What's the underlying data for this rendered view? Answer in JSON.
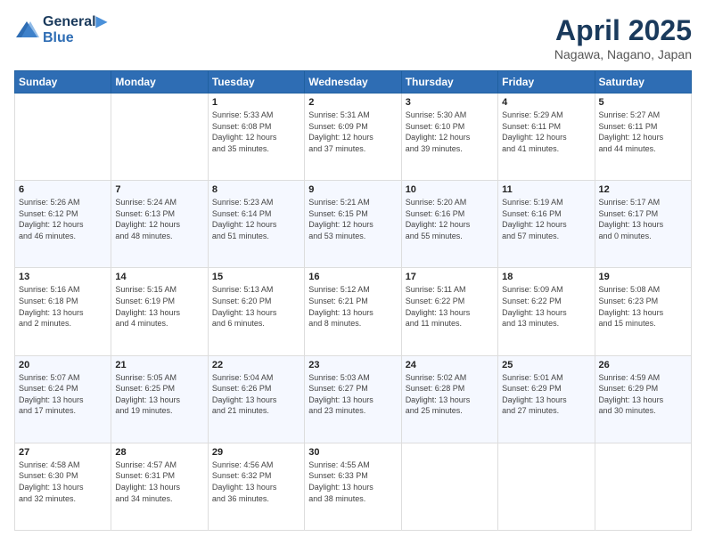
{
  "header": {
    "logo_line1": "General",
    "logo_line2": "Blue",
    "month_title": "April 2025",
    "location": "Nagawa, Nagano, Japan"
  },
  "days_of_week": [
    "Sunday",
    "Monday",
    "Tuesday",
    "Wednesday",
    "Thursday",
    "Friday",
    "Saturday"
  ],
  "weeks": [
    [
      {
        "day": "",
        "info": ""
      },
      {
        "day": "",
        "info": ""
      },
      {
        "day": "1",
        "info": "Sunrise: 5:33 AM\nSunset: 6:08 PM\nDaylight: 12 hours\nand 35 minutes."
      },
      {
        "day": "2",
        "info": "Sunrise: 5:31 AM\nSunset: 6:09 PM\nDaylight: 12 hours\nand 37 minutes."
      },
      {
        "day": "3",
        "info": "Sunrise: 5:30 AM\nSunset: 6:10 PM\nDaylight: 12 hours\nand 39 minutes."
      },
      {
        "day": "4",
        "info": "Sunrise: 5:29 AM\nSunset: 6:11 PM\nDaylight: 12 hours\nand 41 minutes."
      },
      {
        "day": "5",
        "info": "Sunrise: 5:27 AM\nSunset: 6:11 PM\nDaylight: 12 hours\nand 44 minutes."
      }
    ],
    [
      {
        "day": "6",
        "info": "Sunrise: 5:26 AM\nSunset: 6:12 PM\nDaylight: 12 hours\nand 46 minutes."
      },
      {
        "day": "7",
        "info": "Sunrise: 5:24 AM\nSunset: 6:13 PM\nDaylight: 12 hours\nand 48 minutes."
      },
      {
        "day": "8",
        "info": "Sunrise: 5:23 AM\nSunset: 6:14 PM\nDaylight: 12 hours\nand 51 minutes."
      },
      {
        "day": "9",
        "info": "Sunrise: 5:21 AM\nSunset: 6:15 PM\nDaylight: 12 hours\nand 53 minutes."
      },
      {
        "day": "10",
        "info": "Sunrise: 5:20 AM\nSunset: 6:16 PM\nDaylight: 12 hours\nand 55 minutes."
      },
      {
        "day": "11",
        "info": "Sunrise: 5:19 AM\nSunset: 6:16 PM\nDaylight: 12 hours\nand 57 minutes."
      },
      {
        "day": "12",
        "info": "Sunrise: 5:17 AM\nSunset: 6:17 PM\nDaylight: 13 hours\nand 0 minutes."
      }
    ],
    [
      {
        "day": "13",
        "info": "Sunrise: 5:16 AM\nSunset: 6:18 PM\nDaylight: 13 hours\nand 2 minutes."
      },
      {
        "day": "14",
        "info": "Sunrise: 5:15 AM\nSunset: 6:19 PM\nDaylight: 13 hours\nand 4 minutes."
      },
      {
        "day": "15",
        "info": "Sunrise: 5:13 AM\nSunset: 6:20 PM\nDaylight: 13 hours\nand 6 minutes."
      },
      {
        "day": "16",
        "info": "Sunrise: 5:12 AM\nSunset: 6:21 PM\nDaylight: 13 hours\nand 8 minutes."
      },
      {
        "day": "17",
        "info": "Sunrise: 5:11 AM\nSunset: 6:22 PM\nDaylight: 13 hours\nand 11 minutes."
      },
      {
        "day": "18",
        "info": "Sunrise: 5:09 AM\nSunset: 6:22 PM\nDaylight: 13 hours\nand 13 minutes."
      },
      {
        "day": "19",
        "info": "Sunrise: 5:08 AM\nSunset: 6:23 PM\nDaylight: 13 hours\nand 15 minutes."
      }
    ],
    [
      {
        "day": "20",
        "info": "Sunrise: 5:07 AM\nSunset: 6:24 PM\nDaylight: 13 hours\nand 17 minutes."
      },
      {
        "day": "21",
        "info": "Sunrise: 5:05 AM\nSunset: 6:25 PM\nDaylight: 13 hours\nand 19 minutes."
      },
      {
        "day": "22",
        "info": "Sunrise: 5:04 AM\nSunset: 6:26 PM\nDaylight: 13 hours\nand 21 minutes."
      },
      {
        "day": "23",
        "info": "Sunrise: 5:03 AM\nSunset: 6:27 PM\nDaylight: 13 hours\nand 23 minutes."
      },
      {
        "day": "24",
        "info": "Sunrise: 5:02 AM\nSunset: 6:28 PM\nDaylight: 13 hours\nand 25 minutes."
      },
      {
        "day": "25",
        "info": "Sunrise: 5:01 AM\nSunset: 6:29 PM\nDaylight: 13 hours\nand 27 minutes."
      },
      {
        "day": "26",
        "info": "Sunrise: 4:59 AM\nSunset: 6:29 PM\nDaylight: 13 hours\nand 30 minutes."
      }
    ],
    [
      {
        "day": "27",
        "info": "Sunrise: 4:58 AM\nSunset: 6:30 PM\nDaylight: 13 hours\nand 32 minutes."
      },
      {
        "day": "28",
        "info": "Sunrise: 4:57 AM\nSunset: 6:31 PM\nDaylight: 13 hours\nand 34 minutes."
      },
      {
        "day": "29",
        "info": "Sunrise: 4:56 AM\nSunset: 6:32 PM\nDaylight: 13 hours\nand 36 minutes."
      },
      {
        "day": "30",
        "info": "Sunrise: 4:55 AM\nSunset: 6:33 PM\nDaylight: 13 hours\nand 38 minutes."
      },
      {
        "day": "",
        "info": ""
      },
      {
        "day": "",
        "info": ""
      },
      {
        "day": "",
        "info": ""
      }
    ]
  ]
}
